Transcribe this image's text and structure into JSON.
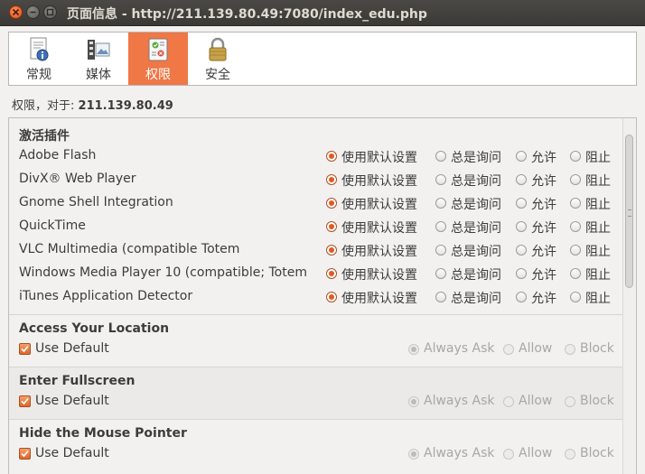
{
  "window": {
    "title": "页面信息 - http://211.139.80.49:7080/index_edu.php"
  },
  "toolbar": {
    "tabs": [
      {
        "label": "常规",
        "icon": "info-document-icon"
      },
      {
        "label": "媒体",
        "icon": "media-film-icon"
      },
      {
        "label": "权限",
        "icon": "permissions-icon",
        "active": true
      },
      {
        "label": "安全",
        "icon": "lock-icon"
      }
    ]
  },
  "permissions_header": {
    "prefix": "权限，对于:",
    "host": "211.139.80.49"
  },
  "plugins": {
    "title": "激活插件",
    "options": [
      "使用默认设置",
      "总是询问",
      "允许",
      "阻止"
    ],
    "items": [
      {
        "name": "Adobe Flash",
        "selected": "使用默认设置"
      },
      {
        "name": "DivX® Web Player",
        "selected": "使用默认设置"
      },
      {
        "name": "Gnome Shell Integration",
        "selected": "使用默认设置"
      },
      {
        "name": "QuickTime",
        "selected": "使用默认设置"
      },
      {
        "name": "VLC Multimedia  (compatible Totem",
        "selected": "使用默认设置"
      },
      {
        "name": "Windows Media Player  10 (compatible; Totem",
        "selected": "使用默认设置"
      },
      {
        "name": "iTunes Application Detector",
        "selected": "使用默认设置"
      }
    ]
  },
  "sections": [
    {
      "title": "Access Your Location",
      "use_default_label": "Use Default",
      "use_default": true,
      "options": [
        "Always Ask",
        "Allow",
        "Block"
      ],
      "selected": "Always Ask"
    },
    {
      "title": "Enter Fullscreen",
      "use_default_label": "Use Default",
      "use_default": true,
      "options": [
        "Always Ask",
        "Allow",
        "Block"
      ],
      "selected": "Always Ask"
    },
    {
      "title": "Hide the Mouse Pointer",
      "use_default_label": "Use Default",
      "use_default": true,
      "options": [
        "Always Ask",
        "Allow",
        "Block"
      ],
      "selected": "Always Ask"
    }
  ],
  "colors": {
    "accent": "#f07746",
    "radio_on": "#e5571b",
    "titlebar": "#3c3b37"
  }
}
